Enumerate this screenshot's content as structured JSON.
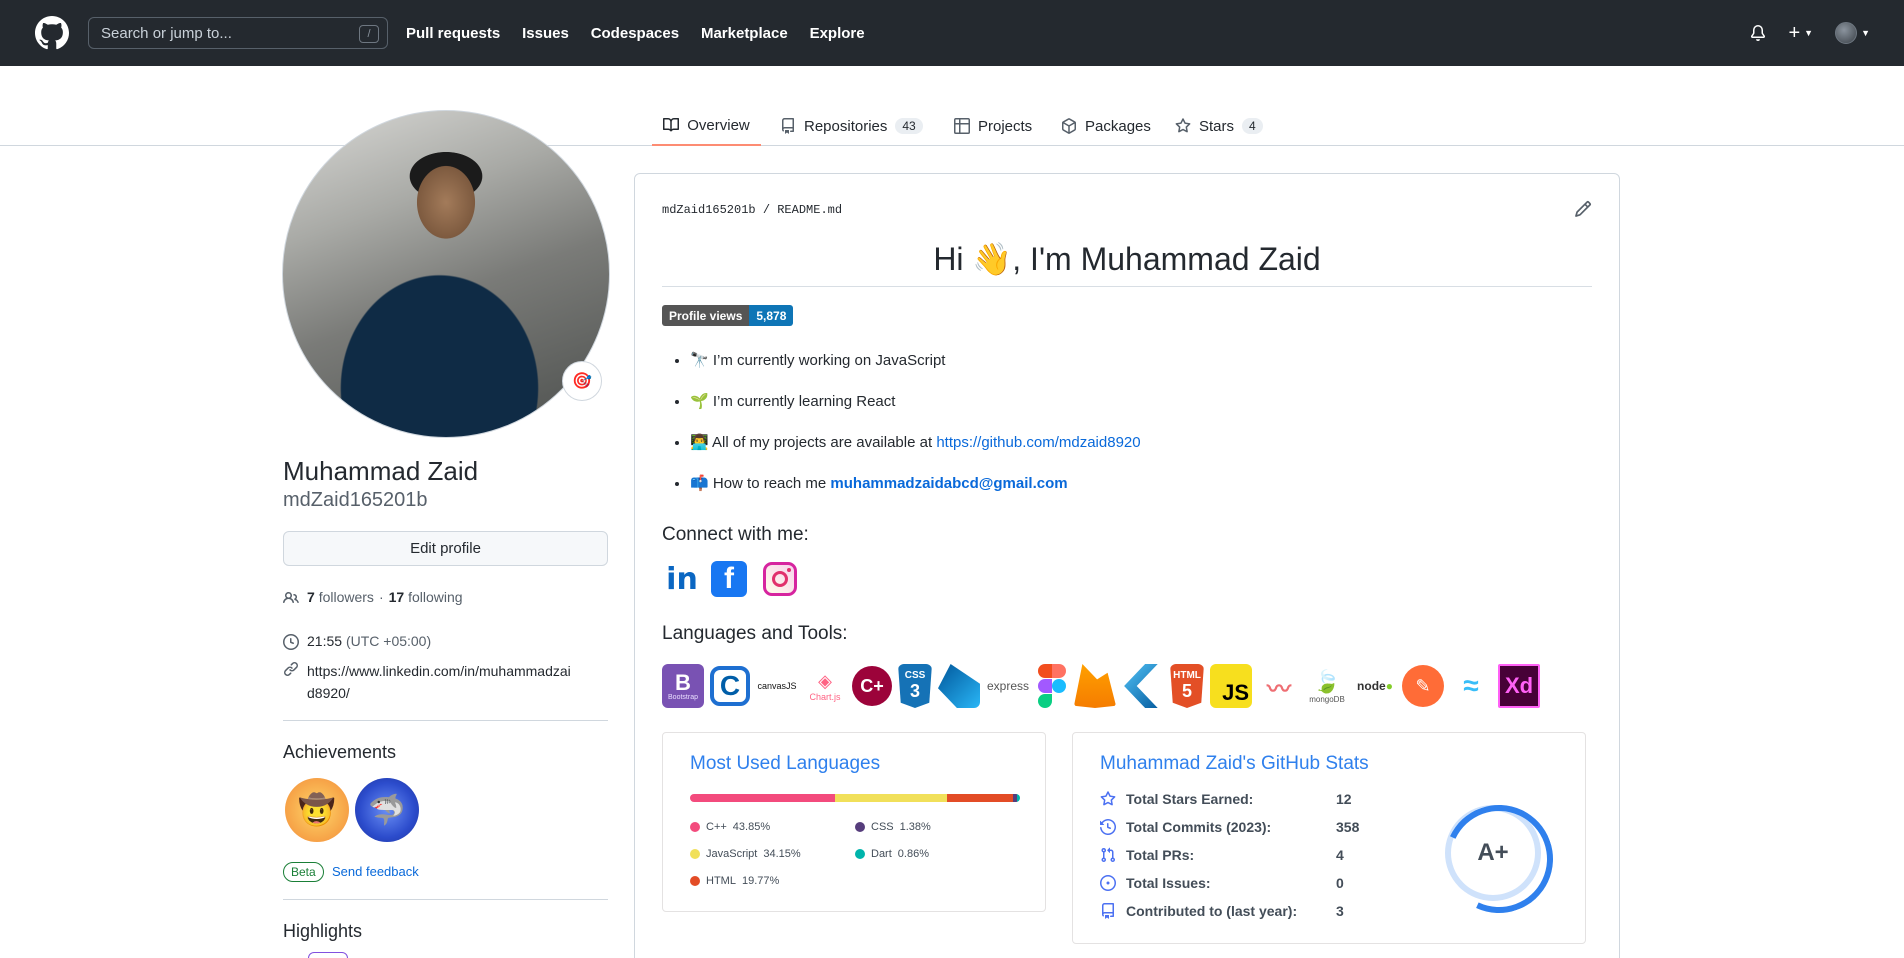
{
  "header": {
    "search_placeholder": "Search or jump to...",
    "search_shortcut": "/",
    "nav": [
      "Pull requests",
      "Issues",
      "Codespaces",
      "Marketplace",
      "Explore"
    ],
    "plus_label": "+"
  },
  "tabs": [
    {
      "label": "Overview",
      "count": ""
    },
    {
      "label": "Repositories",
      "count": "43"
    },
    {
      "label": "Projects",
      "count": ""
    },
    {
      "label": "Packages",
      "count": ""
    },
    {
      "label": "Stars",
      "count": "4"
    }
  ],
  "profile": {
    "name": "Muhammad Zaid",
    "login": "mdZaid165201b",
    "edit_button": "Edit profile",
    "followers_count": "7",
    "followers_label": "followers",
    "separator": "·",
    "following_count": "17",
    "following_label": "following",
    "time": "21:55",
    "timezone": "(UTC +05:00)",
    "link": "https://www.linkedin.com/in/muhammadzaid8920/",
    "link_line1": "https://www.linkedin.com/in/muhammadzai",
    "link_line2": "d8920/",
    "achievements_title": "Achievements",
    "beta_label": "Beta",
    "feedback_label": "Send feedback",
    "highlights_title": "Highlights"
  },
  "readme": {
    "path_user": "mdZaid165201b",
    "path_sep": "/",
    "path_file": "README.md",
    "heading": "Hi 👋, I'm Muhammad Zaid",
    "views_label": "Profile views",
    "views_count": "5,878",
    "bullets": [
      {
        "emoji": "🔭",
        "text": "I’m currently working on ",
        "strong": "JavaScript"
      },
      {
        "emoji": "🌱",
        "text": "I’m currently learning ",
        "strong": "React"
      },
      {
        "emoji": "👨‍💻",
        "text": "All of my projects are available at ",
        "link": "https://github.com/mdzaid8920"
      },
      {
        "emoji": "📫",
        "text": "How to reach me ",
        "link": "muhammadzaidabcd@gmail.com"
      }
    ],
    "connect_title": "Connect with me:",
    "languages_title": "Languages and Tools:"
  },
  "tools": [
    "bootstrap-icon",
    "c-icon",
    "canvasjs-icon",
    "chartjs-icon",
    "cplusplus-icon",
    "css3-icon",
    "dart-icon",
    "express-icon",
    "figma-icon",
    "firebase-icon",
    "flutter-icon",
    "html5-icon",
    "javascript-icon",
    "materialize-icon",
    "mongodb-icon",
    "nodejs-icon",
    "postman-icon",
    "tailwind-icon",
    "xd-icon"
  ],
  "tool_labels": {
    "bootstrap": "Bootstrap",
    "canvasjs": "canvasJS",
    "chartjs": "Chart.js",
    "css": "CSS",
    "express": "express",
    "html": "HTML",
    "js": "JS",
    "mongodb": "mongoDB",
    "node": "node",
    "xd": "Xd"
  },
  "languages_card": {
    "title": "Most Used Languages",
    "items": [
      {
        "name": "C++",
        "percent": "43.85%",
        "color": "#f34b7d"
      },
      {
        "name": "JavaScript",
        "percent": "34.15%",
        "color": "#f1e05a"
      },
      {
        "name": "HTML",
        "percent": "19.77%",
        "color": "#e34c26"
      },
      {
        "name": "CSS",
        "percent": "1.38%",
        "color": "#563d7c"
      },
      {
        "name": "Dart",
        "percent": "0.86%",
        "color": "#00b4ab"
      }
    ]
  },
  "stats_card": {
    "title": "Muhammad Zaid's GitHub Stats",
    "rows": [
      {
        "label": "Total Stars Earned:",
        "value": "12"
      },
      {
        "label": "Total Commits (2023):",
        "value": "358"
      },
      {
        "label": "Total PRs:",
        "value": "4"
      },
      {
        "label": "Total Issues:",
        "value": "0"
      },
      {
        "label": "Contributed to (last year):",
        "value": "3"
      }
    ],
    "rank": "A+"
  },
  "colors": {
    "header_bg": "#24292f",
    "link": "#0969da",
    "tab_underline": "#fd8c73",
    "stats_title": "#2f80ed"
  }
}
